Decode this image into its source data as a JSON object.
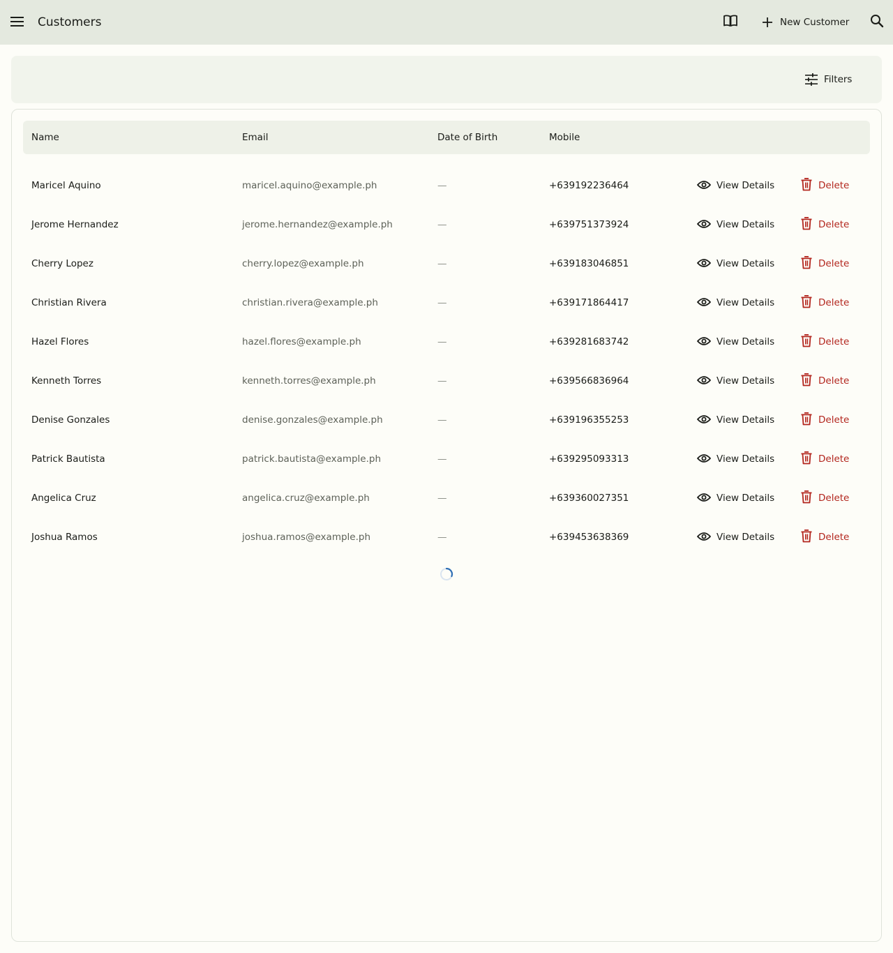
{
  "appbar": {
    "title": "Customers",
    "new_customer_label": "New Customer"
  },
  "filterbar": {
    "filters_label": "Filters"
  },
  "table": {
    "columns": [
      "Name",
      "Email",
      "Date of Birth",
      "Mobile"
    ],
    "view_label": "View Details",
    "delete_label": "Delete",
    "rows": [
      {
        "name": "Maricel Aquino",
        "email": "maricel.aquino@example.ph",
        "dob": "—",
        "mobile": "+639192236464"
      },
      {
        "name": "Jerome Hernandez",
        "email": "jerome.hernandez@example.ph",
        "dob": "—",
        "mobile": "+639751373924"
      },
      {
        "name": "Cherry Lopez",
        "email": "cherry.lopez@example.ph",
        "dob": "—",
        "mobile": "+639183046851"
      },
      {
        "name": "Christian Rivera",
        "email": "christian.rivera@example.ph",
        "dob": "—",
        "mobile": "+639171864417"
      },
      {
        "name": "Hazel Flores",
        "email": "hazel.flores@example.ph",
        "dob": "—",
        "mobile": "+639281683742"
      },
      {
        "name": "Kenneth Torres",
        "email": "kenneth.torres@example.ph",
        "dob": "—",
        "mobile": "+639566836964"
      },
      {
        "name": "Denise Gonzales",
        "email": "denise.gonzales@example.ph",
        "dob": "—",
        "mobile": "+639196355253"
      },
      {
        "name": "Patrick Bautista",
        "email": "patrick.bautista@example.ph",
        "dob": "—",
        "mobile": "+639295093313"
      },
      {
        "name": "Angelica Cruz",
        "email": "angelica.cruz@example.ph",
        "dob": "—",
        "mobile": "+639360027351"
      },
      {
        "name": "Joshua Ramos",
        "email": "joshua.ramos@example.ph",
        "dob": "—",
        "mobile": "+639453638369"
      }
    ]
  },
  "colors": {
    "appbar_bg": "#e4e9df",
    "danger": "#b3261e",
    "spinner": "#2f6fb5"
  }
}
